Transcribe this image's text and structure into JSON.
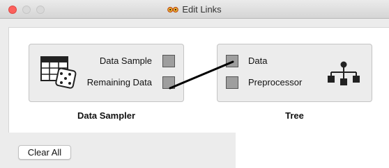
{
  "window": {
    "title": "Edit Links"
  },
  "source_node": {
    "name": "Data Sampler",
    "channels": [
      "Data Sample",
      "Remaining Data"
    ]
  },
  "sink_node": {
    "name": "Tree",
    "channels": [
      "Data",
      "Preprocessor"
    ]
  },
  "links": [
    {
      "from": "Remaining Data",
      "to": "Data"
    }
  ],
  "buttons": {
    "clear_all": "Clear All"
  },
  "icons": {
    "title": "glasses-icon",
    "source": "data-sampler-icon",
    "sink": "tree-icon"
  },
  "colors": {
    "close": "#fc605c",
    "channel_box": "#9e9e9e",
    "link": "#000000"
  }
}
